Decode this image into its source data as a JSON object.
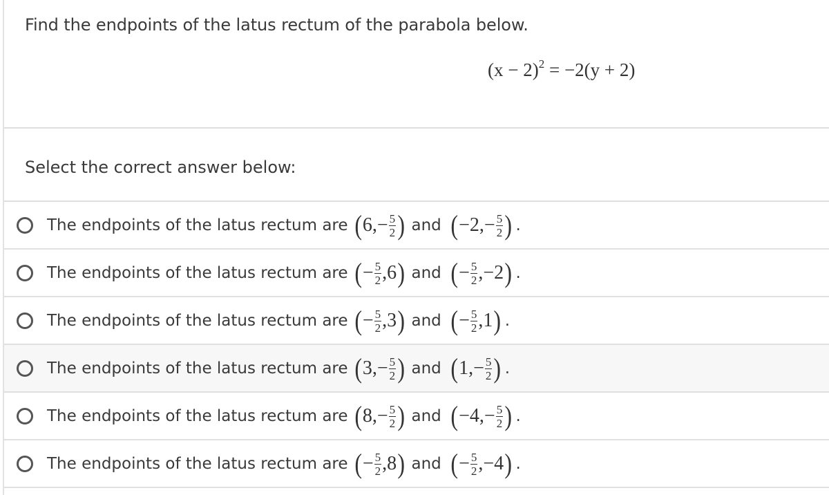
{
  "question": {
    "text": "Find the endpoints of the latus rectum of the parabola below.",
    "equation": {
      "lhs_base": "(x − 2)",
      "lhs_exp": "2",
      "rhs": " = −2(y + 2)"
    }
  },
  "prompt": "Select the correct answer below:",
  "choices": [
    {
      "lead": "The endpoints of the latus rectum are",
      "conjunction": "and",
      "p1": [
        {
          "t": "int",
          "v": "6"
        },
        {
          "t": "frac",
          "sign": "−",
          "num": "5",
          "den": "2"
        }
      ],
      "p2": [
        {
          "t": "int",
          "v": "−2"
        },
        {
          "t": "frac",
          "sign": "−",
          "num": "5",
          "den": "2"
        }
      ],
      "selected": false,
      "hover": false
    },
    {
      "lead": "The endpoints of the latus rectum are",
      "conjunction": "and",
      "p1": [
        {
          "t": "frac",
          "sign": "−",
          "num": "5",
          "den": "2"
        },
        {
          "t": "int",
          "v": "6"
        }
      ],
      "p2": [
        {
          "t": "frac",
          "sign": "−",
          "num": "5",
          "den": "2"
        },
        {
          "t": "int",
          "v": "−2"
        }
      ],
      "selected": false,
      "hover": false
    },
    {
      "lead": "The endpoints of the latus rectum are",
      "conjunction": "and",
      "p1": [
        {
          "t": "frac",
          "sign": "−",
          "num": "5",
          "den": "2"
        },
        {
          "t": "int",
          "v": "3"
        }
      ],
      "p2": [
        {
          "t": "frac",
          "sign": "−",
          "num": "5",
          "den": "2"
        },
        {
          "t": "int",
          "v": "1"
        }
      ],
      "selected": false,
      "hover": false
    },
    {
      "lead": "The endpoints of the latus rectum are",
      "conjunction": "and",
      "p1": [
        {
          "t": "int",
          "v": "3"
        },
        {
          "t": "frac",
          "sign": "−",
          "num": "5",
          "den": "2"
        }
      ],
      "p2": [
        {
          "t": "int",
          "v": "1"
        },
        {
          "t": "frac",
          "sign": "−",
          "num": "5",
          "den": "2"
        }
      ],
      "selected": false,
      "hover": true
    },
    {
      "lead": "The endpoints of the latus rectum are",
      "conjunction": "and",
      "p1": [
        {
          "t": "int",
          "v": "8"
        },
        {
          "t": "frac",
          "sign": "−",
          "num": "5",
          "den": "2"
        }
      ],
      "p2": [
        {
          "t": "int",
          "v": "−4"
        },
        {
          "t": "frac",
          "sign": "−",
          "num": "5",
          "den": "2"
        }
      ],
      "selected": false,
      "hover": false
    },
    {
      "lead": "The endpoints of the latus rectum are",
      "conjunction": "and",
      "p1": [
        {
          "t": "frac",
          "sign": "−",
          "num": "5",
          "den": "2"
        },
        {
          "t": "int",
          "v": "8"
        }
      ],
      "p2": [
        {
          "t": "frac",
          "sign": "−",
          "num": "5",
          "den": "2"
        },
        {
          "t": "int",
          "v": "−4"
        }
      ],
      "selected": false,
      "hover": false
    }
  ],
  "colors": {
    "text": "#3a3a3a",
    "divider": "#dedede",
    "hover_bg": "#f7f7f7",
    "radio_border": "#555555"
  }
}
